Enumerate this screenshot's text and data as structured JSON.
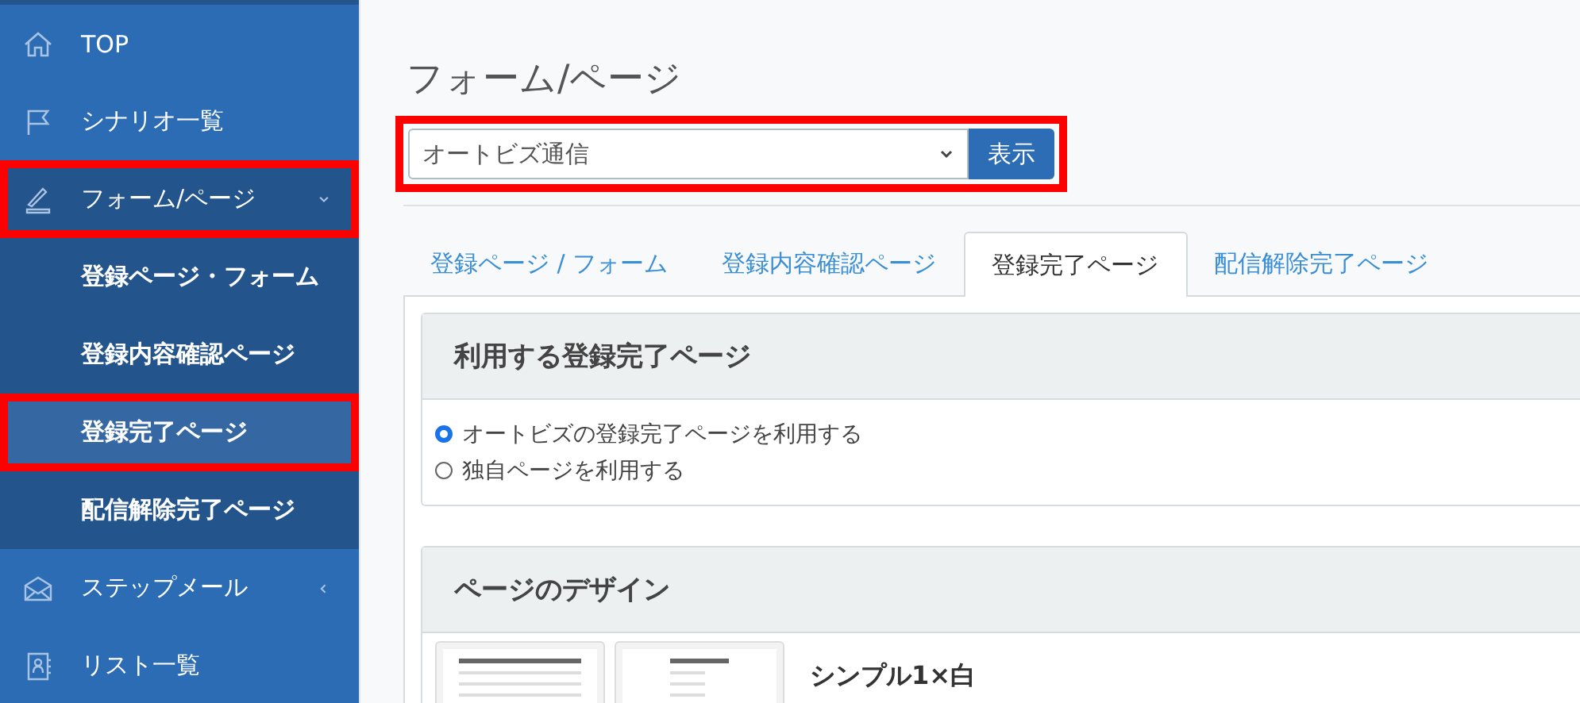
{
  "sidebar": {
    "items": [
      {
        "label": "TOP",
        "highlighted": false,
        "expanded": false
      },
      {
        "label": "シナリオ一覧",
        "highlighted": false,
        "expanded": false
      },
      {
        "label": "フォーム/ページ",
        "highlighted": true,
        "expanded": true,
        "children": [
          {
            "label": "登録ページ・フォーム",
            "selected": false,
            "highlighted": false
          },
          {
            "label": "登録内容確認ページ",
            "selected": false,
            "highlighted": false
          },
          {
            "label": "登録完了ページ",
            "selected": true,
            "highlighted": true
          },
          {
            "label": "配信解除完了ページ",
            "selected": false,
            "highlighted": false
          }
        ]
      },
      {
        "label": "ステップメール",
        "highlighted": false,
        "expanded": false
      },
      {
        "label": "リスト一覧",
        "highlighted": false,
        "expanded": false
      }
    ]
  },
  "page_title": "フォーム/ページ",
  "selector": {
    "value": "オートビズ通信",
    "button": "表示",
    "highlighted": true
  },
  "tabs": [
    {
      "label": "登録ページ / フォーム",
      "selected": false
    },
    {
      "label": "登録内容確認ページ",
      "selected": false
    },
    {
      "label": "登録完了ページ",
      "selected": true
    },
    {
      "label": "配信解除完了ページ",
      "selected": false
    }
  ],
  "usage_panel": {
    "title": "利用する登録完了ページ",
    "options": [
      {
        "label": "オートビズの登録完了ページを利用する",
        "selected": true
      },
      {
        "label": "独自ページを利用する",
        "selected": false
      }
    ]
  },
  "design_panel": {
    "title": "ページのデザイン",
    "design_name": "シンプル1×白"
  }
}
